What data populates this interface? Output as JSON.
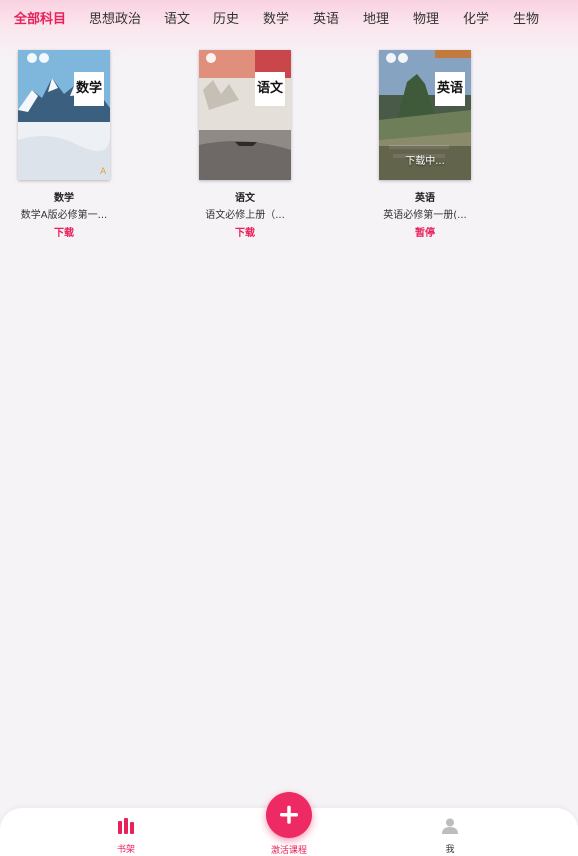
{
  "subject_tabs": [
    "全部科目",
    "思想政治",
    "语文",
    "历史",
    "数学",
    "英语",
    "地理",
    "物理",
    "化学",
    "生物"
  ],
  "active_tab_index": 0,
  "books": [
    {
      "subject": "数学",
      "desc": "数学A版必修第一...",
      "action": "下载",
      "cover_title": "数学",
      "overlay": ""
    },
    {
      "subject": "语文",
      "desc": "语文必修上册（...",
      "action": "下载",
      "cover_title": "语文",
      "overlay": ""
    },
    {
      "subject": "英语",
      "desc": "英语必修第一册(...",
      "action": "暂停",
      "cover_title": "英语",
      "overlay": "下载中..."
    }
  ],
  "bottom_nav": {
    "bookshelf_label": "书架",
    "activate_label": "激活课程",
    "me_label": "我"
  },
  "colors": {
    "accent": "#e8215a",
    "fab": "#ee2a64"
  }
}
